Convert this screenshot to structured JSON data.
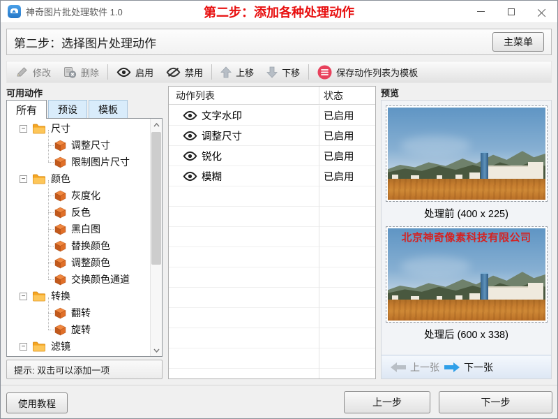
{
  "window": {
    "title": "神奇图片批处理软件 1.0",
    "step_banner": "第二步：添加各种处理动作",
    "controls": [
      "minimize",
      "maximize",
      "close"
    ]
  },
  "header": {
    "title": "第二步：选择图片处理动作",
    "main_menu_label": "主菜单"
  },
  "toolbar": {
    "items": [
      {
        "name": "modify-button",
        "label": "修改",
        "icon": "pencil-icon",
        "enabled": false,
        "sep_after": false
      },
      {
        "name": "delete-button",
        "label": "删除",
        "icon": "delete-icon",
        "enabled": false,
        "sep_after": true
      },
      {
        "name": "enable-button",
        "label": "启用",
        "icon": "eye-icon",
        "enabled": true,
        "sep_after": false
      },
      {
        "name": "disable-button",
        "label": "禁用",
        "icon": "eye-off-icon",
        "enabled": true,
        "sep_after": true
      },
      {
        "name": "move-up-button",
        "label": "上移",
        "icon": "arrow-up-icon",
        "enabled": true,
        "sep_after": false
      },
      {
        "name": "move-down-button",
        "label": "下移",
        "icon": "arrow-down-icon",
        "enabled": true,
        "sep_after": true
      },
      {
        "name": "save-template-button",
        "label": "保存动作列表为模板",
        "icon": "save-list-icon",
        "enabled": true,
        "sep_after": false
      }
    ]
  },
  "available_actions": {
    "title": "可用动作",
    "tabs": [
      {
        "label": "所有",
        "active": true
      },
      {
        "label": "预设",
        "active": false
      },
      {
        "label": "模板",
        "active": false
      }
    ],
    "tree": [
      {
        "label": "尺寸",
        "children": [
          "调整尺寸",
          "限制图片尺寸"
        ]
      },
      {
        "label": "颜色",
        "children": [
          "灰度化",
          "反色",
          "黑白图",
          "替换颜色",
          "调整颜色",
          "交换颜色通道"
        ]
      },
      {
        "label": "转换",
        "children": [
          "翻转",
          "旋转"
        ]
      },
      {
        "label": "滤镜",
        "children": []
      }
    ],
    "hint": "提示: 双击可以添加一项"
  },
  "action_list": {
    "columns": [
      "动作列表",
      "状态"
    ],
    "rows": [
      {
        "name": "文字水印",
        "status": "已启用"
      },
      {
        "name": "调整尺寸",
        "status": "已启用"
      },
      {
        "name": "锐化",
        "status": "已启用"
      },
      {
        "name": "模糊",
        "status": "已启用"
      }
    ]
  },
  "preview": {
    "title": "预览",
    "before_caption": "处理前 (400 x 225)",
    "after_caption": "处理后 (600 x 338)",
    "watermark": "北京神奇像素科技有限公司",
    "prev_label": "上一张",
    "next_label": "下一张"
  },
  "footer": {
    "tutorial": "使用教程",
    "back": "上一步",
    "next": "下一步"
  },
  "colors": {
    "banner_red": "#e81010",
    "watermark_red": "#d42222",
    "save_icon_red": "#e8415c",
    "tab_inactive_blue": "#d9ecfb",
    "next_arrow_blue": "#2f9fe8",
    "ground_orange": "#c67d2f"
  }
}
